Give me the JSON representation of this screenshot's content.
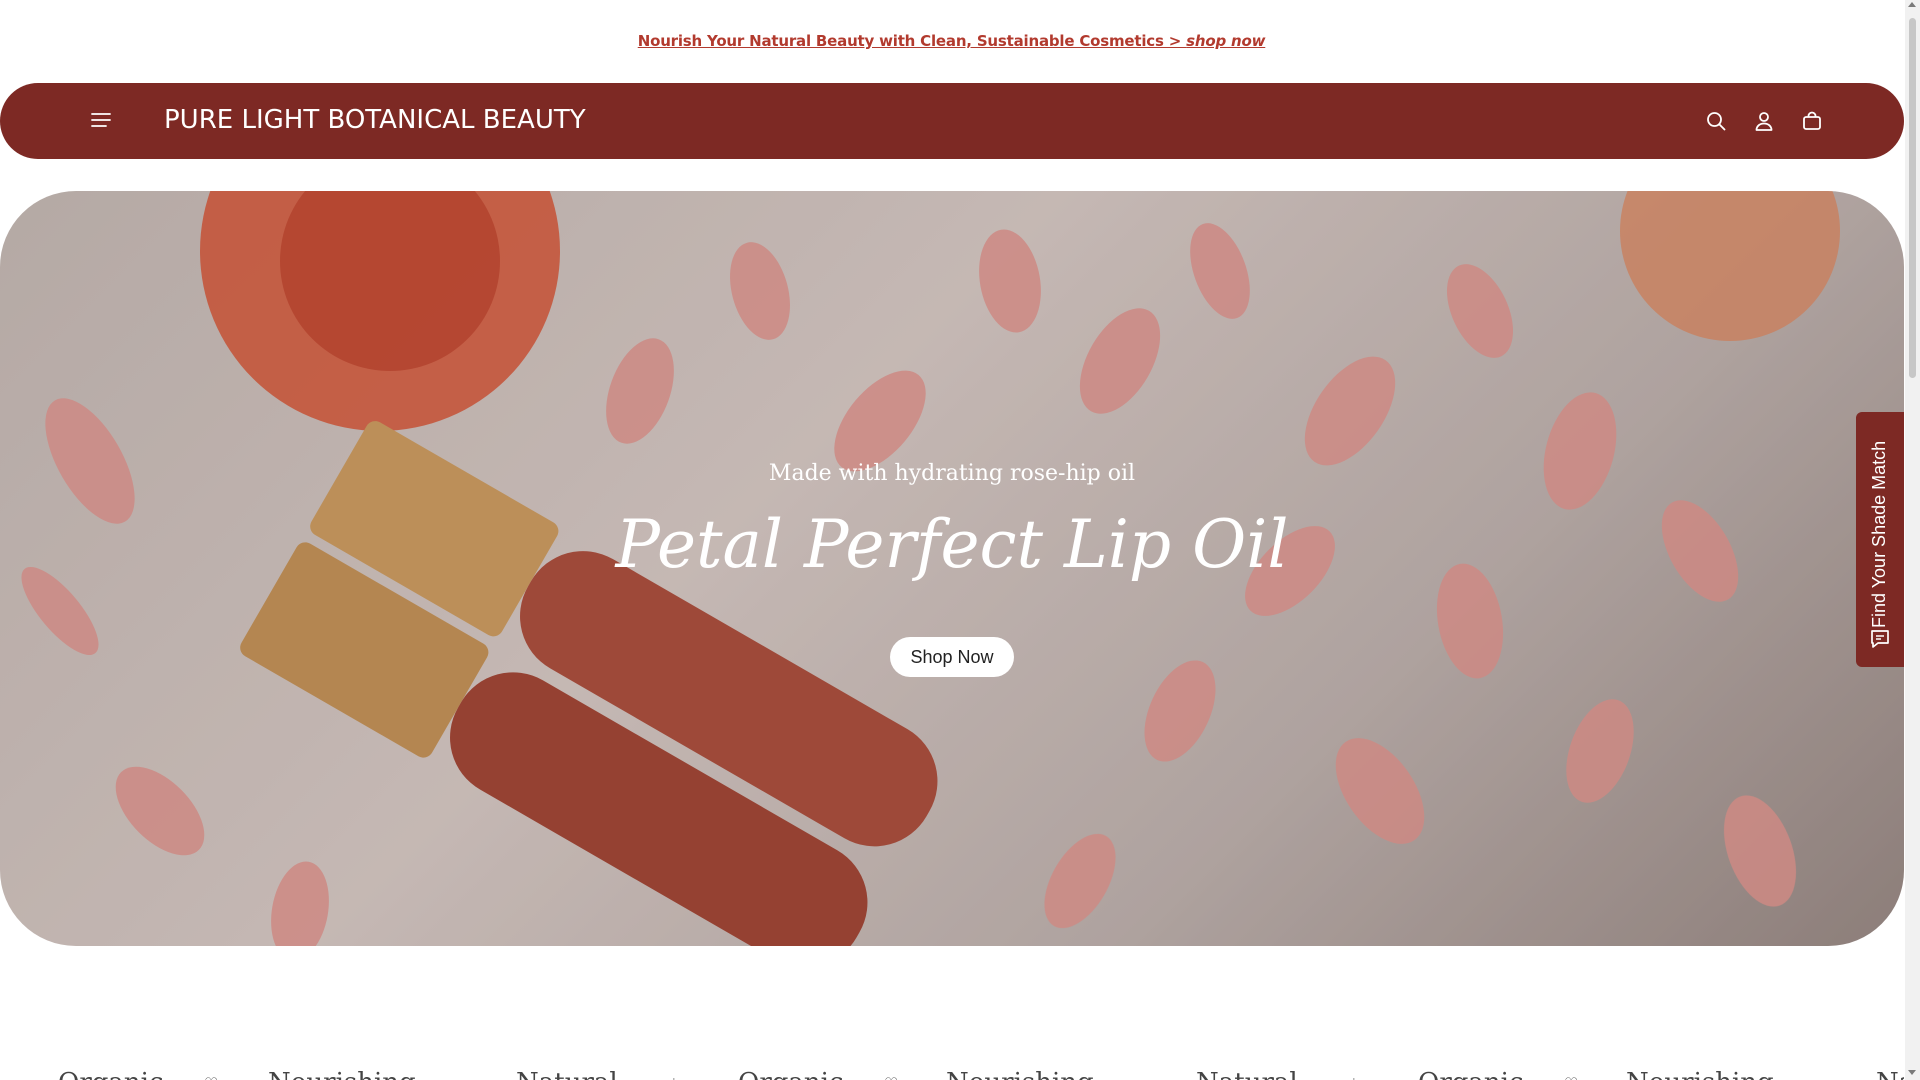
{
  "announcement": {
    "text": "Nourish Your Natural Beauty with Clean, Sustainable Cosmetics > ",
    "cta": "shop now"
  },
  "header": {
    "logo": "PURE LIGHT BOTANICAL BEAUTY",
    "icons": [
      "menu-icon",
      "search-icon",
      "account-icon",
      "cart-icon"
    ]
  },
  "hero": {
    "subtitle": "Made with hydrating rose-hip oil",
    "title": "Petal Perfect Lip Oil",
    "button": "Shop Now"
  },
  "shade_match": {
    "label": "Find Your Shade Match"
  },
  "ticker": {
    "items": [
      "Organic",
      "Nourishing",
      "Natural",
      "Organic",
      "Nourishing",
      "Natural",
      "Organic",
      "Nourishing",
      "Na"
    ]
  },
  "colors": {
    "brand": "#7d2924",
    "link": "#b23a2e"
  }
}
